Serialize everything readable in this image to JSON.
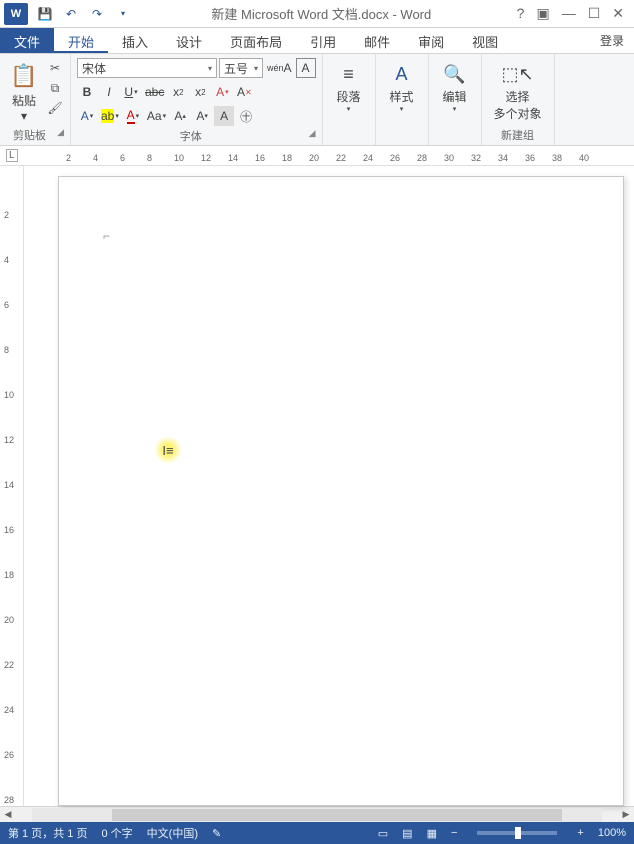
{
  "title": "新建 Microsoft Word 文档.docx - Word",
  "app_icon_text": "W",
  "login_label": "登录",
  "file_tab": "文件",
  "tabs": [
    "开始",
    "插入",
    "设计",
    "页面布局",
    "引用",
    "邮件",
    "审阅",
    "视图"
  ],
  "active_tab_index": 0,
  "clipboard": {
    "paste": "粘贴",
    "group": "剪贴板"
  },
  "font": {
    "name": "宋体",
    "size": "五号",
    "group": "字体",
    "phonetic": "wén",
    "enclose": "A"
  },
  "paragraph": {
    "label": "段落"
  },
  "styles": {
    "label": "样式"
  },
  "editing": {
    "label": "编辑"
  },
  "select": {
    "line1": "选择",
    "line2": "多个对象",
    "group": "新建组"
  },
  "ruler_h": [
    "2",
    "4",
    "6",
    "8",
    "10",
    "12",
    "14",
    "16",
    "18",
    "20",
    "22",
    "24",
    "26",
    "28",
    "30",
    "32",
    "34",
    "36",
    "38",
    "40"
  ],
  "ruler_v": [
    "2",
    "4",
    "6",
    "8",
    "10",
    "12",
    "14",
    "16",
    "18",
    "20",
    "22",
    "24",
    "26",
    "28"
  ],
  "status": {
    "page": "第 1 页，共 1 页",
    "words": "0 个字",
    "lang": "中文(中国)",
    "zoom": "100%"
  }
}
